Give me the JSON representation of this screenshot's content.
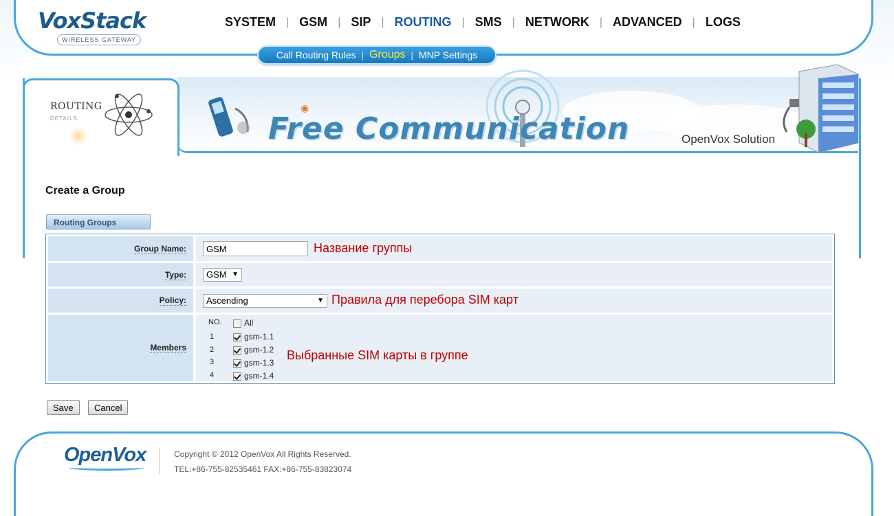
{
  "brand": {
    "logo_text": "VoxStack",
    "logo_sub": "WIRELESS GATEWAY"
  },
  "nav": {
    "items": [
      "SYSTEM",
      "GSM",
      "SIP",
      "ROUTING",
      "SMS",
      "NETWORK",
      "ADVANCED",
      "LOGS"
    ],
    "active": "ROUTING"
  },
  "subnav": {
    "items": [
      "Call Routing Rules",
      "Groups",
      "MNP Settings"
    ],
    "active": "Groups"
  },
  "banner": {
    "section_title": "ROUTING",
    "section_sub": "DETAILS",
    "headline": "Free Communication",
    "tagline": "OpenVox Solution"
  },
  "form": {
    "title": "Create a Group",
    "tab_label": "Routing Groups",
    "group_name_label": "Group Name:",
    "group_name_value": "GSM",
    "group_name_note": "Название группы",
    "type_label": "Type:",
    "type_value": "GSM",
    "policy_label": "Policy:",
    "policy_value": "Ascending",
    "policy_note": "Правила для перебора SIM карт",
    "members_label": "Members",
    "members_header_no": "NO.",
    "members_all_label": "All",
    "members_note": "Выбранные SIM карты в группе",
    "members": [
      {
        "no": "1",
        "name": "gsm-1.1",
        "checked": true
      },
      {
        "no": "2",
        "name": "gsm-1.2",
        "checked": true
      },
      {
        "no": "3",
        "name": "gsm-1.3",
        "checked": true
      },
      {
        "no": "4",
        "name": "gsm-1.4",
        "checked": true
      }
    ],
    "save_label": "Save",
    "cancel_label": "Cancel"
  },
  "footer": {
    "logo": "OpenVox",
    "copyright": "Copyright © 2012 OpenVox All Rights Reserved.",
    "contact": "TEL:+86-755-82535461 FAX:+86-755-83823074"
  },
  "colors": {
    "frame_blue": "#4aa7d8",
    "active_nav": "#1c5c9e",
    "note_red": "#c00000",
    "label_bg": "#d3e3f1",
    "value_bg": "#e8eff6"
  }
}
